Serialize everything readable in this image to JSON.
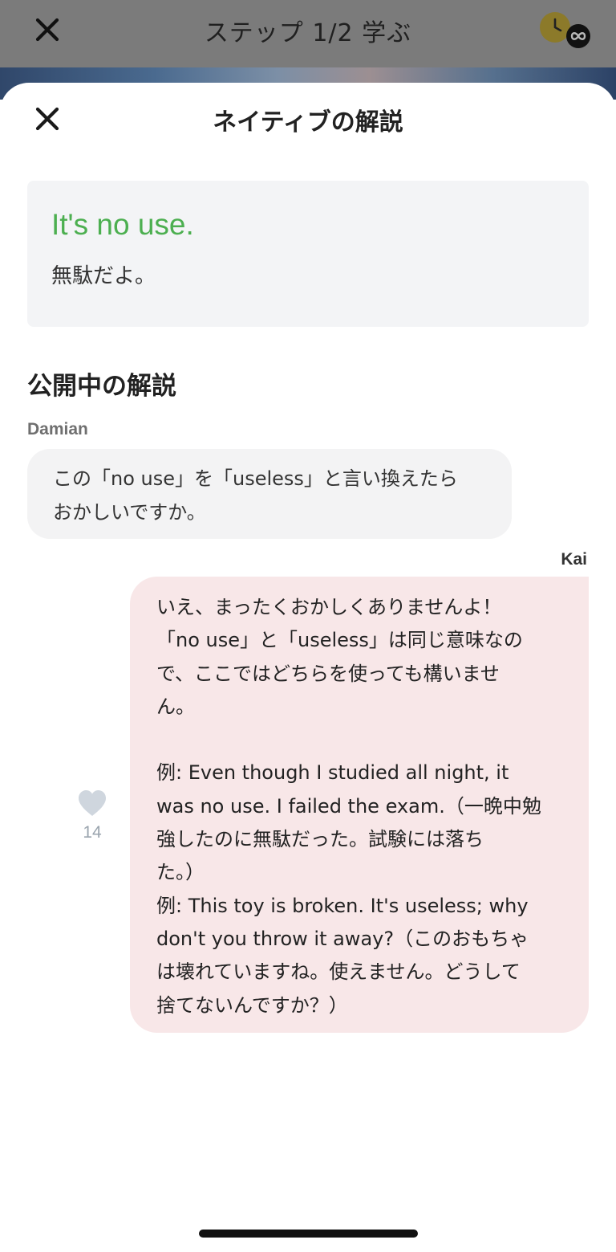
{
  "background": {
    "step_title": "ステップ 1/2 学ぶ"
  },
  "sheet": {
    "title": "ネイティブの解説"
  },
  "phrase": {
    "english": "It's no use.",
    "japanese": "無駄だよ。"
  },
  "comments_section": {
    "title": "公開中の解説"
  },
  "question": {
    "author": "Damian",
    "text": "この「no use」を「useless」と言い換えたら\nおかしいですか。"
  },
  "answer": {
    "author": "Kai",
    "text": "いえ、まったくおかしくありませんよ！\n「no use」と「useless」は同じ意味なの\nで、ここではどちらを使っても構いませ\nん。\n\n例: Even though I studied all night, it\nwas no use. I failed the exam.（一晩中勉\n強したのに無駄だった。試験には落ち\nた。）\n例: This toy is broken. It's useless; why\ndon't you throw it away?（このおもちゃ\nは壊れていますね。使えません。どうして\n捨てないんですか？）",
    "like_count": "14"
  },
  "colors": {
    "accent_green": "#4caf50",
    "question_bubble": "#f3f3f4",
    "answer_bubble": "#f8e7e8",
    "like_icon": "#cfd6de"
  },
  "icons": {
    "close": "close-icon",
    "timer": "timer-icon",
    "infinity": "infinity-icon",
    "like": "heart-icon"
  }
}
